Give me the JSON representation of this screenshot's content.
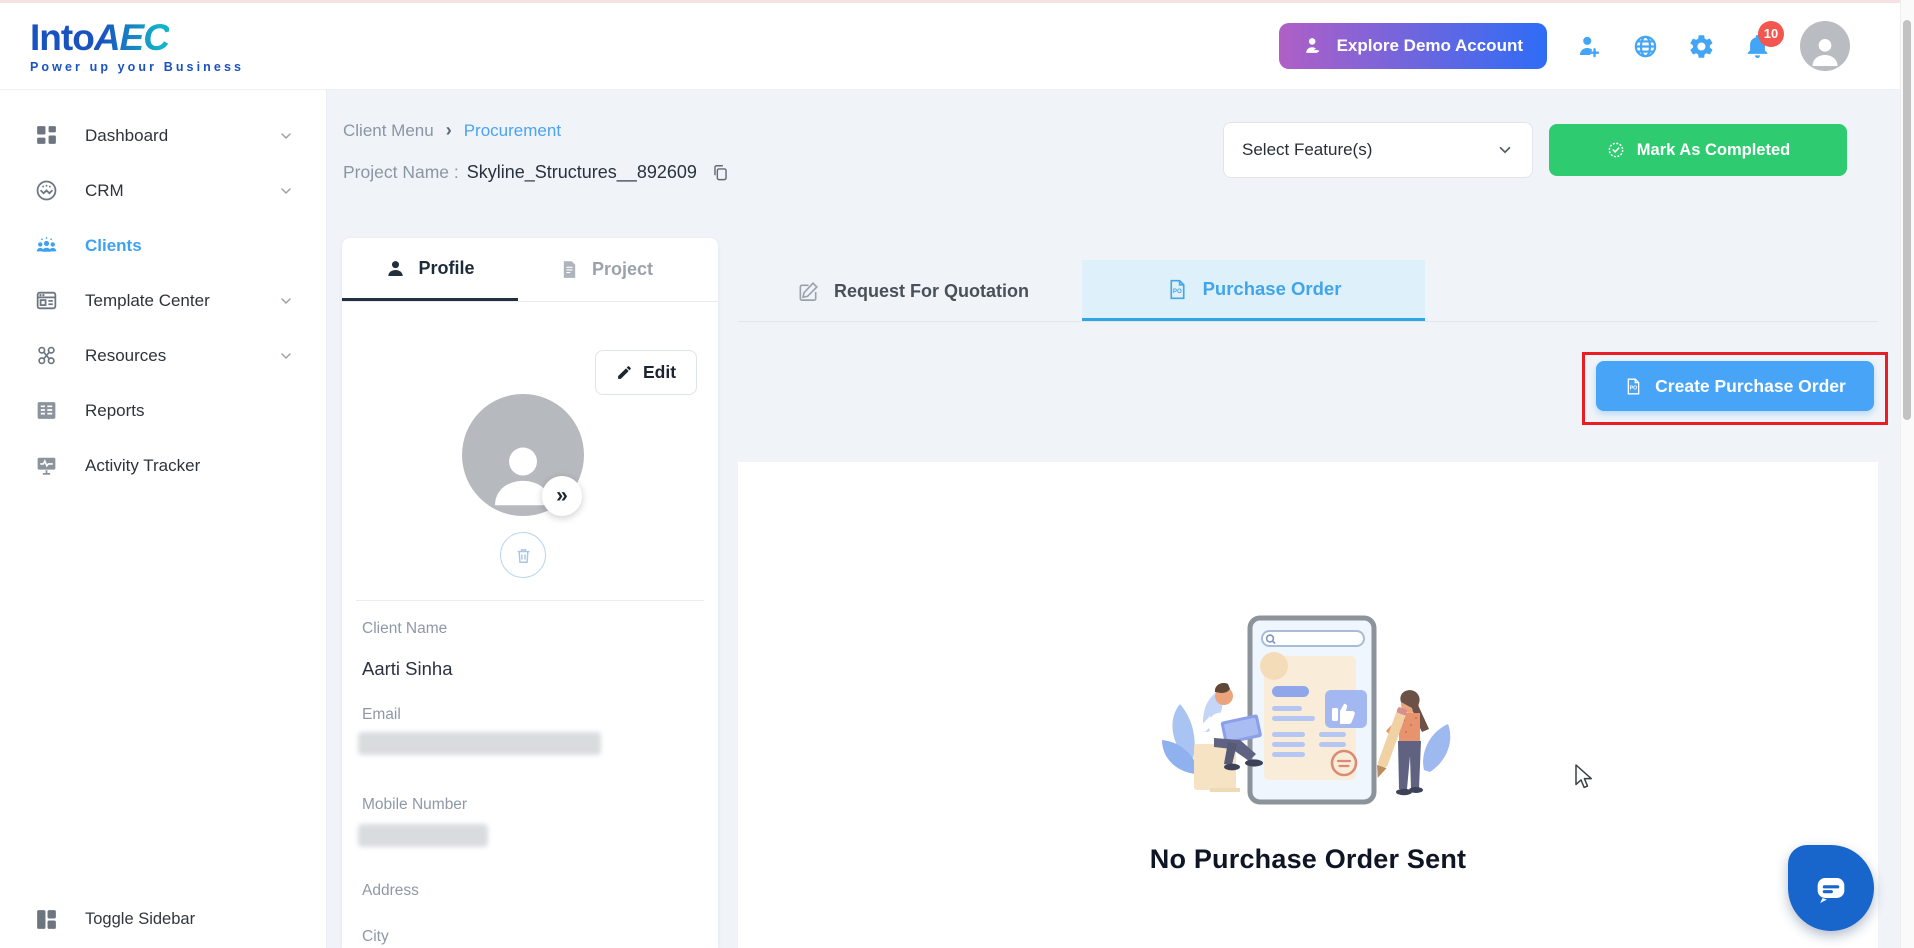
{
  "header": {
    "brand": {
      "into": "Into",
      "aec": "AEC",
      "tagline": "Power up your Business"
    },
    "explore_demo_label": "Explore Demo Account",
    "notification_count": "10",
    "icons": [
      "add-user-icon",
      "globe-icon",
      "settings-icon",
      "bell-icon",
      "avatar"
    ]
  },
  "sidebar": {
    "items": [
      {
        "label": "Dashboard",
        "icon": "dashboard-icon",
        "expandable": true,
        "active": false
      },
      {
        "label": "CRM",
        "icon": "crm-icon",
        "expandable": true,
        "active": false
      },
      {
        "label": "Clients",
        "icon": "clients-icon",
        "expandable": false,
        "active": true
      },
      {
        "label": "Template Center",
        "icon": "template-center-icon",
        "expandable": true,
        "active": false
      },
      {
        "label": "Resources",
        "icon": "resources-icon",
        "expandable": true,
        "active": false
      },
      {
        "label": "Reports",
        "icon": "reports-icon",
        "expandable": false,
        "active": false
      },
      {
        "label": "Activity Tracker",
        "icon": "activity-tracker-icon",
        "expandable": false,
        "active": false
      }
    ],
    "toggle_label": "Toggle Sidebar"
  },
  "breadcrumb": {
    "parent": "Client Menu",
    "current": "Procurement"
  },
  "project": {
    "label": "Project Name :",
    "name": "Skyline_Structures__892609"
  },
  "header_actions": {
    "select_features": "Select Feature(s)",
    "mark_completed": "Mark As Completed"
  },
  "profile_card": {
    "tabs": {
      "profile": "Profile",
      "project": "Project"
    },
    "edit_label": "Edit",
    "expand_glyph": "»",
    "fields": {
      "client_name_label": "Client Name",
      "client_name_value": "Aarti Sinha",
      "email_label": "Email",
      "email_redacted": true,
      "mobile_label": "Mobile Number",
      "mobile_redacted": true,
      "address_label": "Address",
      "city_label": "City"
    }
  },
  "content": {
    "tabs": {
      "rfq": "Request For Quotation",
      "po": "Purchase Order"
    },
    "create_po_label": "Create Purchase Order",
    "empty_state_text": "No Purchase Order Sent"
  },
  "colors": {
    "accent_blue": "#47a4f7",
    "po_tab_blue": "#42a5ea",
    "success_green": "#2fcb71",
    "badge_red": "#f3564f",
    "annotation_red": "#ea1c24",
    "chat_blue": "#1866cc",
    "brand_navy": "#1a53c0",
    "brand_teal": "#14b4c8",
    "sidebar_active": "#3fa1f4"
  }
}
